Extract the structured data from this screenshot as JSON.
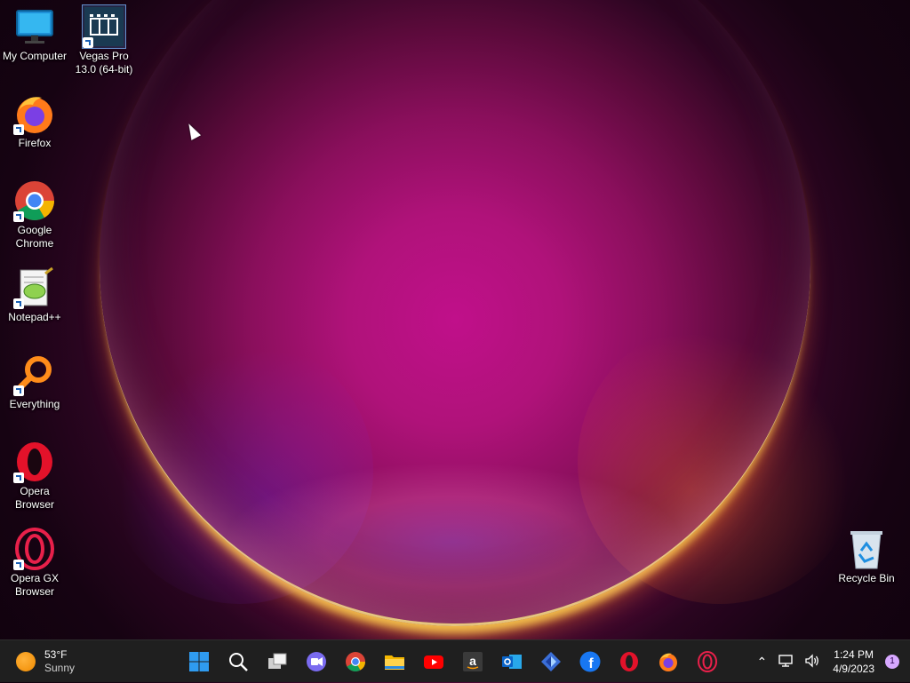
{
  "desktop": {
    "icons": [
      {
        "label": "My Computer"
      },
      {
        "label": "Vegas Pro 13.0 (64-bit)"
      },
      {
        "label": "Firefox"
      },
      {
        "label": "Google Chrome"
      },
      {
        "label": "Notepad++"
      },
      {
        "label": "Everything"
      },
      {
        "label": "Opera Browser"
      },
      {
        "label": "Opera GX Browser"
      },
      {
        "label": "Recycle Bin"
      }
    ]
  },
  "taskbar": {
    "weather": {
      "temp": "53°F",
      "condition": "Sunny",
      "icon": "sun-icon"
    },
    "pinned": [
      {
        "name": "start",
        "icon": "windows-logo-icon"
      },
      {
        "name": "search",
        "icon": "search-icon"
      },
      {
        "name": "task-view",
        "icon": "task-view-icon"
      },
      {
        "name": "chat",
        "icon": "teams-chat-icon"
      },
      {
        "name": "chrome",
        "icon": "chrome-icon"
      },
      {
        "name": "file-explorer",
        "icon": "folder-icon"
      },
      {
        "name": "youtube",
        "icon": "youtube-icon"
      },
      {
        "name": "amazon",
        "icon": "amazon-icon"
      },
      {
        "name": "outlook",
        "icon": "outlook-icon"
      },
      {
        "name": "photos",
        "icon": "photos-icon"
      },
      {
        "name": "facebook",
        "icon": "facebook-icon"
      },
      {
        "name": "opera",
        "icon": "opera-icon"
      },
      {
        "name": "firefox",
        "icon": "firefox-icon"
      },
      {
        "name": "opera-gx",
        "icon": "opera-gx-icon"
      }
    ],
    "tray": {
      "time": "1:24 PM",
      "date": "4/9/2023",
      "notification_count": "1"
    }
  },
  "colors": {
    "taskbar_bg": "#1f1f1f",
    "accent": "#0078d4"
  }
}
